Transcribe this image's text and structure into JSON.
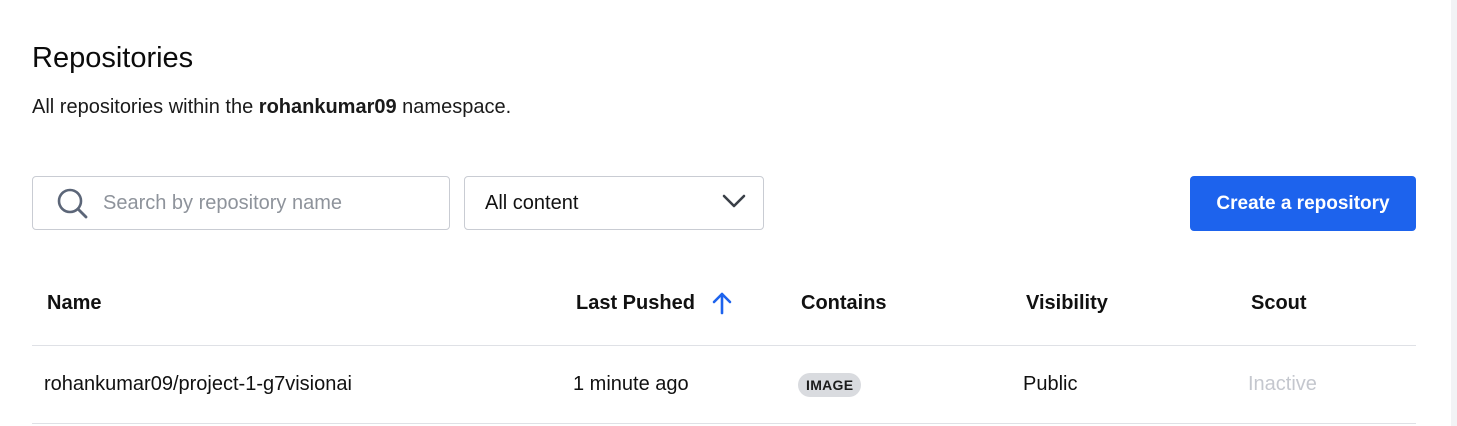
{
  "header": {
    "title": "Repositories",
    "subtitle_prefix": "All repositories within the ",
    "namespace": "rohankumar09",
    "subtitle_suffix": " namespace."
  },
  "search": {
    "placeholder": "Search by repository name",
    "value": "",
    "icon": "search-icon"
  },
  "filter": {
    "selected": "All content",
    "icon": "chevron-down-icon"
  },
  "actions": {
    "create_label": "Create a repository",
    "create_color": "#1d63ed"
  },
  "table": {
    "columns": {
      "name": "Name",
      "last_pushed": "Last Pushed",
      "contains": "Contains",
      "visibility": "Visibility",
      "scout": "Scout"
    },
    "sort": {
      "column": "Last Pushed",
      "direction": "ascending",
      "icon": "arrow-up-icon",
      "color": "#1d63ed"
    },
    "rows": [
      {
        "name": "rohankumar09/project-1-g7visionai",
        "last_pushed": "1 minute ago",
        "contains": "IMAGE",
        "visibility": "Public",
        "scout": "Inactive"
      }
    ]
  }
}
